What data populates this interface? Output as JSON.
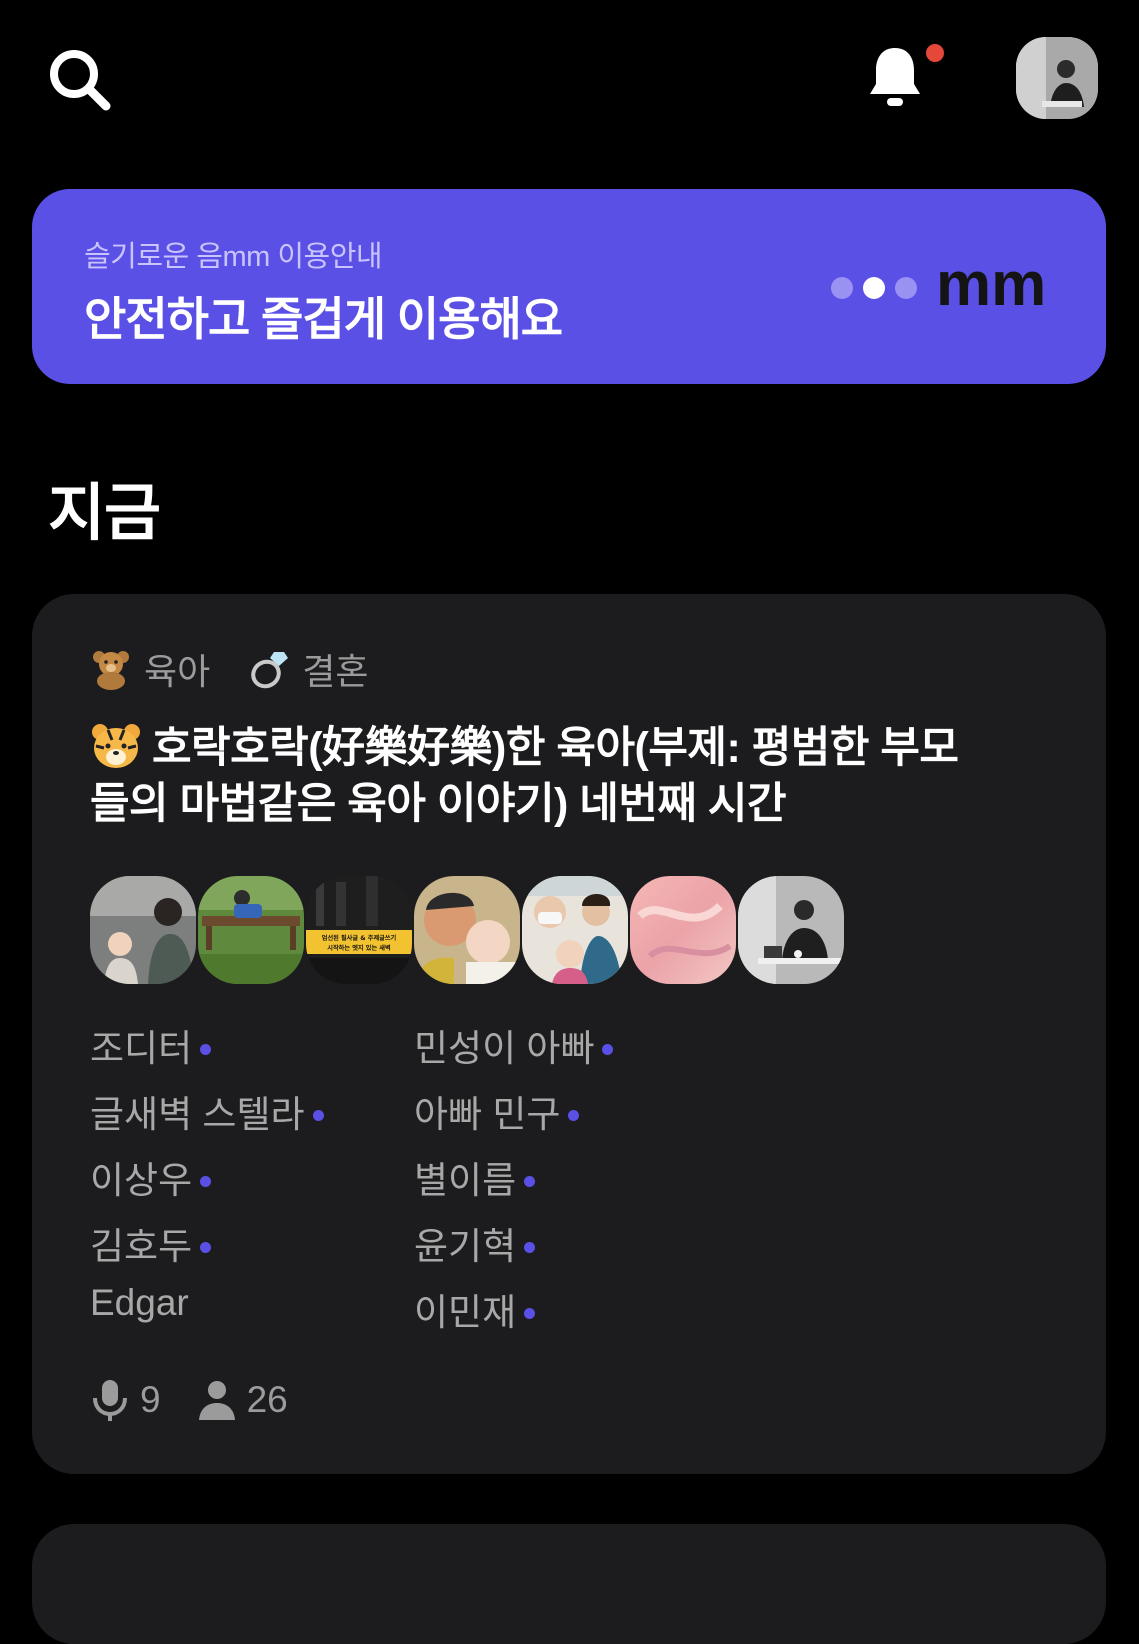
{
  "header": {
    "search_icon": "search-icon",
    "bell_icon": "bell-icon",
    "notification_color": "#e5473a"
  },
  "banner": {
    "subtitle": "슬기로운 음mm 이용안내",
    "title": "안전하고 즐겁게 이용해요",
    "logo_text": "mm",
    "background": "#5b50e6"
  },
  "section": {
    "title": "지금"
  },
  "room": {
    "tags": [
      {
        "icon": "teddy-bear-icon",
        "label": "육아"
      },
      {
        "icon": "ring-icon",
        "label": "결혼"
      }
    ],
    "title_emoji": "tiger-face-icon",
    "title": "호락호락(好樂好樂)한 육아(부제: 평범한 부모들의 마법같은 육아 이야기) 네번째 시간",
    "speaker_avatars": [
      "mother-child-photo",
      "park-bench-photo",
      "book-cover-photo",
      "father-baby-photo",
      "family-selfie-photo",
      "pink-paint-photo",
      "man-laptop-photo"
    ],
    "book_cover_text": [
      "엄선된 필사글 & 주제글쓰기",
      "시작하는 엣지 있는 새벽"
    ],
    "names_left": [
      {
        "name": "조디터",
        "speaking": true
      },
      {
        "name": "글새벽 스텔라",
        "speaking": true
      },
      {
        "name": "이상우",
        "speaking": true
      },
      {
        "name": "김호두",
        "speaking": true
      },
      {
        "name": "Edgar",
        "speaking": false
      }
    ],
    "names_right": [
      {
        "name": "민성이 아빠",
        "speaking": true
      },
      {
        "name": "아빠 민구",
        "speaking": true
      },
      {
        "name": "별이름",
        "speaking": true
      },
      {
        "name": "윤기혁",
        "speaking": true
      },
      {
        "name": "이민재",
        "speaking": true
      }
    ],
    "speaker_count": "9",
    "listener_count": "26",
    "accent_color": "#5b50e6"
  }
}
